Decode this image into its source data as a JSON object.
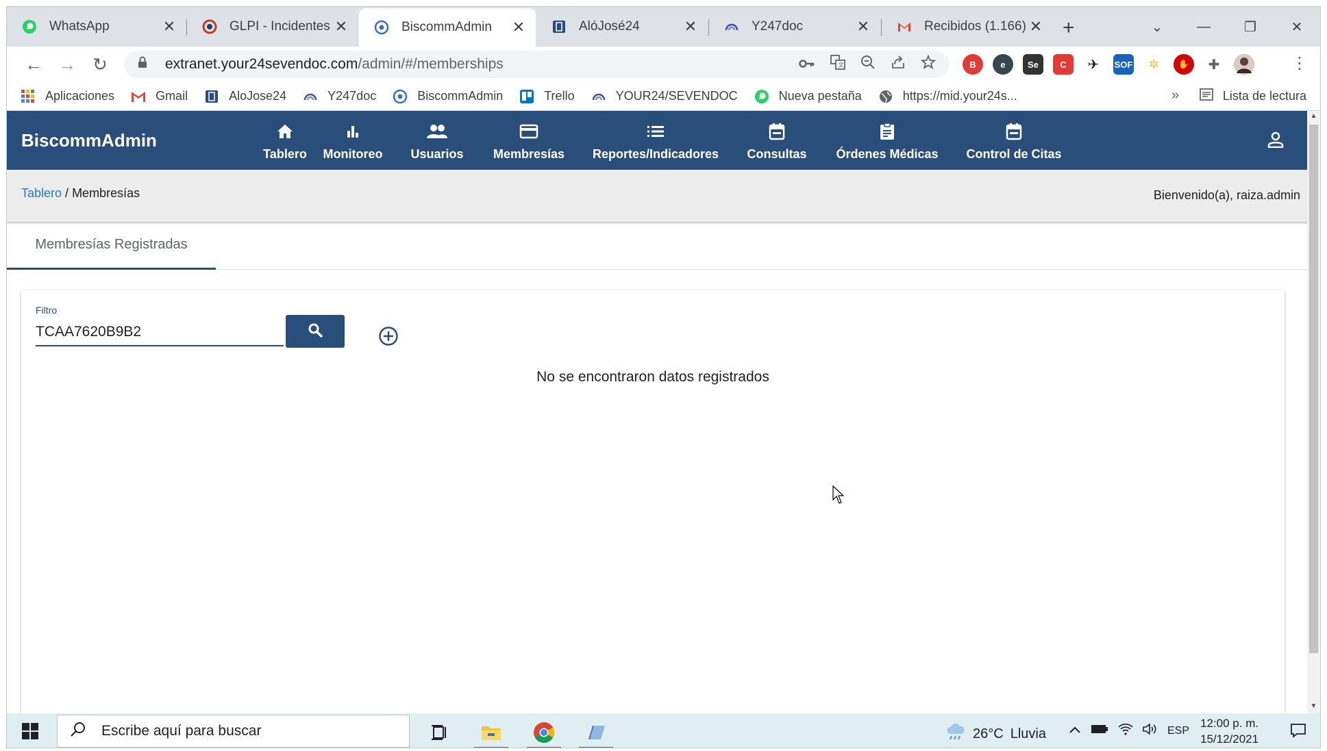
{
  "browser": {
    "tabs": [
      {
        "title": "WhatsApp",
        "icon": "whatsapp-icon",
        "active": false
      },
      {
        "title": "GLPI - Incidentes -",
        "icon": "glpi-icon",
        "active": false
      },
      {
        "title": "BiscommAdmin",
        "icon": "biscomm-icon",
        "active": true
      },
      {
        "title": "AlóJosé24",
        "icon": "alojose-icon",
        "active": false
      },
      {
        "title": "Y247doc",
        "icon": "y247doc-icon",
        "active": false
      },
      {
        "title": "Recibidos (1.166) -",
        "icon": "gmail-icon",
        "active": false
      }
    ],
    "close_glyph": "✕",
    "new_tab_glyph": "+",
    "url_host": "extranet.your24sevendoc.com",
    "url_path": "/admin/#/memberships",
    "bookmarks": [
      {
        "label": "Aplicaciones",
        "icon": "apps-grid-icon"
      },
      {
        "label": "Gmail",
        "icon": "gmail-icon"
      },
      {
        "label": "AloJose24",
        "icon": "alojose-icon"
      },
      {
        "label": "Y247doc",
        "icon": "y247doc-icon"
      },
      {
        "label": "BiscommAdmin",
        "icon": "biscomm-icon"
      },
      {
        "label": "Trello",
        "icon": "trello-icon"
      },
      {
        "label": "YOUR24/SEVENDOC",
        "icon": "y247doc-icon"
      },
      {
        "label": "Nueva pestaña",
        "icon": "whatsapp-icon"
      },
      {
        "label": "https://mid.your24s...",
        "icon": "globe-icon"
      }
    ],
    "bookmarks_more": "»",
    "reading_list": "Lista de lectura"
  },
  "app": {
    "brand": "BiscommAdmin",
    "nav": [
      {
        "label": "Tablero",
        "icon": "home-icon"
      },
      {
        "label": "Monitoreo",
        "icon": "bar-chart-icon"
      },
      {
        "label": "Usuarios",
        "icon": "users-icon"
      },
      {
        "label": "Membresías",
        "icon": "credit-card-icon"
      },
      {
        "label": "Reportes/Indicadores",
        "icon": "list-icon"
      },
      {
        "label": "Consultas",
        "icon": "calendar-icon"
      },
      {
        "label": "Órdenes Médicas",
        "icon": "clipboard-icon"
      },
      {
        "label": "Control de Citas",
        "icon": "calendar-icon"
      }
    ],
    "breadcrumb": {
      "root": "Tablero",
      "separator": " / ",
      "current": "Membresías"
    },
    "welcome": "Bienvenido(a), raiza.admin",
    "page_tab": "Membresías Registradas",
    "filter": {
      "label": "Filtro",
      "value": "TCAA7620B9B2"
    },
    "empty_message": "No se encontraron datos registrados"
  },
  "taskbar": {
    "search_placeholder": "Escribe aquí para buscar",
    "weather_temp": "26°C",
    "weather_desc": "Lluvia",
    "language": "ESP",
    "time": "12:00 p. m.",
    "date": "15/12/2021"
  },
  "colors": {
    "app_header": "#2a4e7a",
    "link": "#2a77c9",
    "tabstrip": "#dee1e6"
  }
}
